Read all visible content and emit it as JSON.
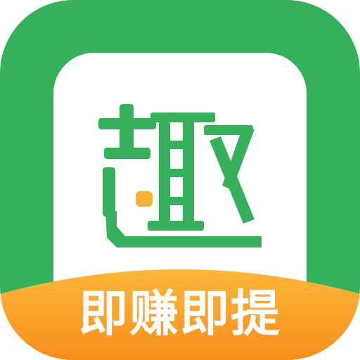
{
  "app_icon": {
    "logo_text": "趣",
    "slogan": "即赚即提",
    "colors": {
      "background": "#37b05b",
      "card": "#ffffff",
      "logo": "#37b05b",
      "accent_dot": "#f7b339",
      "banner_top": "#fdb73b",
      "banner_bottom": "#f78e1c",
      "slogan_text": "#ffffff"
    }
  }
}
